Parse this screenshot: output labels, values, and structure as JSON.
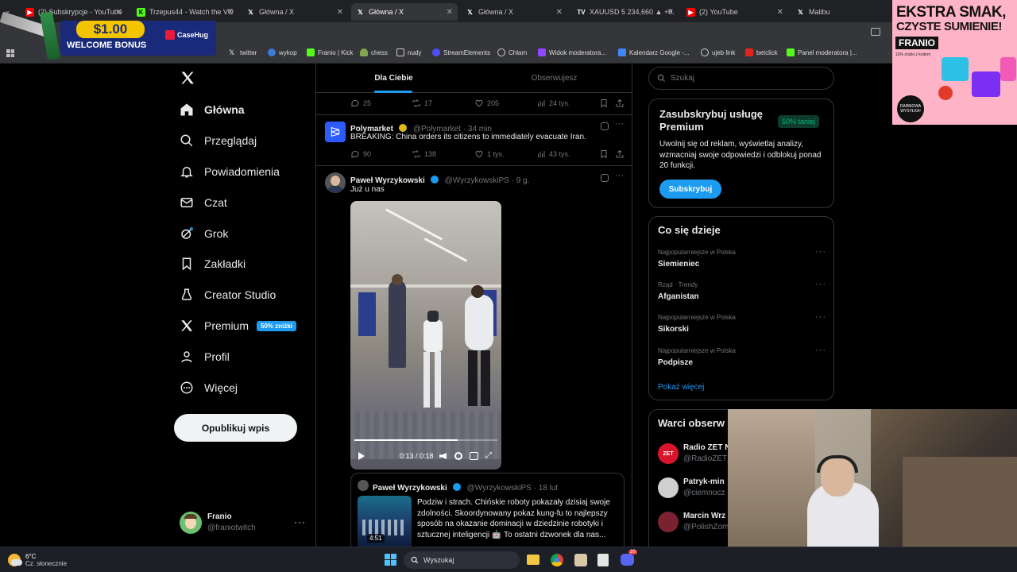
{
  "browser": {
    "tabs": [
      {
        "label": "(2) Subskrypcje - YouTube",
        "icon": "youtube-icon",
        "color": "#ff0000"
      },
      {
        "label": "Trzepus44 - Watch the VO",
        "icon": "kick-icon",
        "color": "#53fc18"
      },
      {
        "label": "Główna / X",
        "icon": "x-icon",
        "color": "#ffffff"
      },
      {
        "label": "Główna / X",
        "icon": "x-icon",
        "color": "#ffffff"
      },
      {
        "label": "Główna / X",
        "icon": "x-icon",
        "color": "#ffffff"
      },
      {
        "label": "XAUUSD 5 234,660 ▲ +0.",
        "icon": "tradingview-icon",
        "color": "#ffffff"
      },
      {
        "label": "(2) YouTube",
        "icon": "youtube-icon",
        "color": "#ff0000"
      },
      {
        "label": "Malibu",
        "icon": "x-icon",
        "color": "#ffffff"
      }
    ],
    "bookmarks": [
      "twitter",
      "wykop",
      "Franio | Kick",
      "chess",
      "nudy",
      "StreamElements",
      "Chłam",
      "Widok moderatora...",
      "Kalendarz Google -...",
      "ujeb link",
      "betclick",
      "Panel moderatora |..."
    ]
  },
  "overlays": {
    "promo_amount": "$1.00",
    "promo_text": "WELCOME BONUS",
    "promo_brand": "CaseHug",
    "ad_headline_1": "EKSTRA SMAK,",
    "ad_headline_2": "CZYSTE SUMIENIE!",
    "ad_brand": "FRANIO",
    "ad_sub": "10% zniżki z kodem",
    "ad_badge": "DARMOWA WYSYŁKA!"
  },
  "nav": {
    "items": [
      {
        "label": "Główna",
        "icon": "home-icon"
      },
      {
        "label": "Przeglądaj",
        "icon": "search-icon"
      },
      {
        "label": "Powiadomienia",
        "icon": "bell-icon"
      },
      {
        "label": "Czat",
        "icon": "mail-icon"
      },
      {
        "label": "Grok",
        "icon": "grok-icon"
      },
      {
        "label": "Zakładki",
        "icon": "bookmark-icon"
      },
      {
        "label": "Creator Studio",
        "icon": "creator-icon"
      },
      {
        "label": "Premium",
        "icon": "x-logo-icon"
      },
      {
        "label": "Profil",
        "icon": "person-icon"
      },
      {
        "label": "Więcej",
        "icon": "more-circle-icon"
      }
    ],
    "premium_badge": "50% zniżki",
    "post_button": "Opublikuj wpis",
    "user_name": "Franio",
    "user_handle": "@franiotwitch"
  },
  "feed": {
    "tab_for_you": "Dla Ciebie",
    "tab_following": "Obserwujesz",
    "top_actions": {
      "replies": "25",
      "reposts": "17",
      "likes": "205",
      "views": "24 tys."
    },
    "tweet1": {
      "name": "Polymarket",
      "handle": "@Polymarket · 34 min",
      "text": "BREAKING: China orders its citizens to immediately evacuate Iran.",
      "replies": "90",
      "reposts": "138",
      "likes": "1 tys.",
      "views": "43 tys."
    },
    "tweet2": {
      "name": "Paweł Wyrzykowski",
      "handle": "@WyrzykowskiPS · 9 g.",
      "text": "Już u nas",
      "video_time": "0:13 / 0:18",
      "video_progress": 0.72
    },
    "quote": {
      "name": "Paweł Wyrzykowski",
      "handle": "@WyrzykowskiPS · 18 lut",
      "text": "Podziw i strach. Chińskie roboty pokazały dzisiaj swoje zdolności. Skoordynowany pokaz kung-fu to najlepszy sposób na okazanie dominacji w dziedzinie robotyki i sztucznej inteligencji 🤖 To ostatni dzwonek dla nas...",
      "duration": "4:51"
    }
  },
  "right": {
    "search_placeholder": "Szukaj",
    "premium_title": "Zasubskrybuj usługę Premium",
    "premium_badge": "50% taniej",
    "premium_text": "Uwolnij się od reklam, wyświetlaj analizy, wzmacniaj swoje odpowiedzi i odblokuj ponad 20 funkcji.",
    "premium_button": "Subskrybuj",
    "trends_title": "Co się dzieje",
    "trends": [
      {
        "meta": "Najpopularniejsze w Polska",
        "name": "Siemieniec"
      },
      {
        "meta": "Rząd · Trendy",
        "name": "Afganistan"
      },
      {
        "meta": "Najpopularniejsze w Polska",
        "name": "Sikorski"
      },
      {
        "meta": "Najpopularniejsze w Polska",
        "name": "Podpisze"
      }
    ],
    "show_more": "Pokaż więcej",
    "follow_title": "Warci obserw",
    "follow": [
      {
        "name": "Radio ZET N",
        "handle": "@RadioZET_"
      },
      {
        "name": "Patryk-min",
        "handle": "@ciemnocz"
      },
      {
        "name": "Marcin Wrz",
        "handle": "@PolishZom"
      }
    ]
  },
  "taskbar": {
    "weather_temp": "6°C",
    "weather_desc": "Cz. słonecznie",
    "search": "Wyszukaj",
    "discord_badge": "20"
  },
  "colors": {
    "accent": "#1d9bf0",
    "verified_gold": "#e2b719",
    "premium_green": "#00ba7c"
  }
}
